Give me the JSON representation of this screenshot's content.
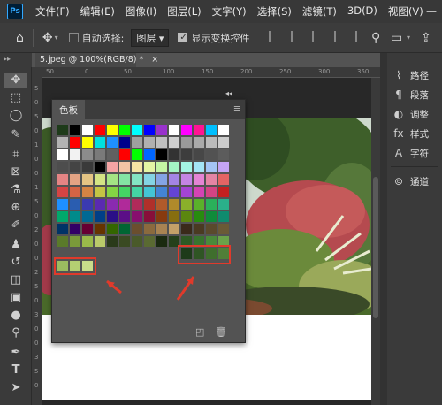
{
  "app": {
    "logo_text": "Ps"
  },
  "menus": [
    "文件(F)",
    "编辑(E)",
    "图像(I)",
    "图层(L)",
    "文字(Y)",
    "选择(S)",
    "滤镜(T)",
    "3D(D)",
    "视图(V)"
  ],
  "window_controls": "—",
  "options_bar": {
    "auto_select_label": "自动选择:",
    "auto_select_checked": false,
    "layer_select_value": "图层",
    "show_transform_label": "显示变换控件",
    "show_transform_checked": true
  },
  "document": {
    "tab_title": "5.jpeg @ 100%(RGB/8) *",
    "ruler_top_numbers": [
      "50",
      "0",
      "50",
      "100",
      "150",
      "200",
      "250",
      "300",
      "350"
    ],
    "ruler_left_numbers": [
      "5",
      "0",
      "5",
      "0",
      "1",
      "0",
      "0",
      "1",
      "5",
      "0",
      "2",
      "0",
      "0",
      "2",
      "5",
      "0",
      "3",
      "0",
      "0",
      "3",
      "5",
      "0"
    ]
  },
  "right_panel": {
    "items": [
      {
        "icon": "path-icon",
        "label": "路径"
      },
      {
        "icon": "paragraph-icon",
        "label": "段落"
      },
      {
        "icon": "adjust-icon",
        "label": "调整"
      },
      {
        "icon": "styles-icon",
        "label": "样式"
      },
      {
        "icon": "character-icon",
        "label": "字符"
      },
      {
        "icon": "channels-icon",
        "label": "通道"
      }
    ]
  },
  "swatches_panel": {
    "title": "色板",
    "collapse_glyph": "◂◂",
    "menu_glyph": "≡",
    "rows": [
      [
        "#1e3b1a",
        "#000000",
        "#ffffff",
        "#ff0000",
        "#ffff00",
        "#00ff00",
        "#00ffff",
        "#0000ff",
        "#9932cc",
        "#ffffff",
        "#ff00ff",
        "#ff1493",
        "#00bfff",
        "#ffffff"
      ],
      [
        "#b3b3b3",
        "#ff0000",
        "#ffff00",
        "#00e0e0",
        "#1e90ff",
        "#00008b",
        "#a0a0a0",
        "#b0b0b0",
        "#c0c0c0",
        "#d0d0d0",
        "#9a9a9a",
        "#aaaaaa",
        "#bbbbbb",
        "#cccccc"
      ],
      [
        "#ffffff",
        "#f2f2f2",
        "#8c8c8c",
        "#7a7a7a",
        "#606060",
        "#ff0000",
        "#00ff00",
        "#0066ff",
        "#000000",
        "#333333",
        "#3d3d3d",
        "#474747",
        "#525252",
        "#5c5c5c"
      ],
      [
        "#4d4d4d",
        "#444444",
        "#3a3a3a",
        "#000000",
        "#f4a4a4",
        "#f4c4a4",
        "#f4e4a4",
        "#e4f4a4",
        "#c4f4a4",
        "#a4f4c4",
        "#a4f4e4",
        "#a4e4f4",
        "#a4c4f4",
        "#c4a4f4"
      ],
      [
        "#e48484",
        "#e4a484",
        "#e4c484",
        "#d4e484",
        "#a4e484",
        "#84e4a4",
        "#84e4c4",
        "#84d4e4",
        "#84a4e4",
        "#a484e4",
        "#c484e4",
        "#e484d4",
        "#e484a4",
        "#e46464"
      ],
      [
        "#d44444",
        "#d46444",
        "#d48444",
        "#c4c444",
        "#84d444",
        "#44d464",
        "#44d4a4",
        "#44c4d4",
        "#4484d4",
        "#6444d4",
        "#a444d4",
        "#d444b4",
        "#d44484",
        "#c42020"
      ],
      [
        "#1e90ff",
        "#2a5db0",
        "#3a3ab0",
        "#5a2ab0",
        "#8a2ab0",
        "#b02a9a",
        "#b02a5a",
        "#b0302a",
        "#b05a2a",
        "#b08a2a",
        "#8ab02a",
        "#5ab02a",
        "#2ab05a",
        "#2ab08a"
      ],
      [
        "#00a86b",
        "#008b8b",
        "#006994",
        "#003f87",
        "#2a0f87",
        "#5b0f87",
        "#870f6e",
        "#870f3a",
        "#873a0f",
        "#876e0f",
        "#5b870f",
        "#278b0f",
        "#0f8b3a",
        "#0f8b6e"
      ],
      [
        "#003366",
        "#330066",
        "#660033",
        "#663300",
        "#336600",
        "#006633",
        "#6b4e2e",
        "#8b6a3e",
        "#a88352",
        "#c4a068",
        "#3a2a1a",
        "#4a3a22",
        "#5a4a2c",
        "#6a5a36"
      ],
      [
        "#5a7a2a",
        "#7a9a3a",
        "#9aba4a",
        "#baca6a",
        "#2a3a1a",
        "#3a4a22",
        "#4a5a2a",
        "#5a6a32",
        "#1a2a10",
        "#24401a",
        "#2e5a24",
        "#38742e",
        "#4a8a3a",
        "#6aa24a"
      ]
    ],
    "bottom_row": [
      "#9bbd60",
      "#b4cf72",
      "#c9dc8a"
    ],
    "dark_green_row": [
      "#1e3b1a",
      "#2f5524",
      "#3f6e2d",
      "#517f38"
    ],
    "footer_icons": [
      "new-swatch-icon",
      "trash-icon"
    ]
  },
  "colors": {
    "highlight_red": "#e03a2b",
    "panel_bg": "#535353",
    "chrome_dark": "#383838"
  }
}
